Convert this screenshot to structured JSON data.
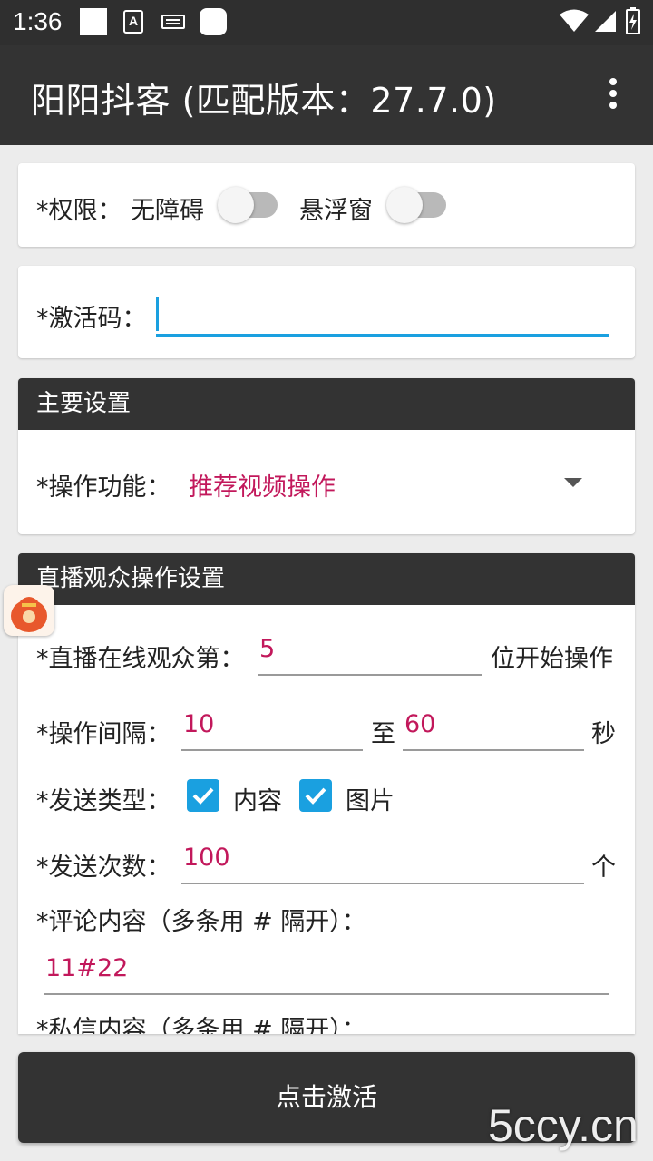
{
  "status_bar": {
    "time": "1:36",
    "icons": [
      "notification-icon",
      "a-icon",
      "keyboard-icon",
      "notification-icon-2",
      "wifi-icon",
      "signal-icon",
      "battery-icon"
    ]
  },
  "app_bar": {
    "title": "阳阳抖客 (匹配版本：27.7.0)",
    "menu_icon": "overflow-menu-icon"
  },
  "permissions": {
    "label": "*权限：",
    "accessibility_label": "无障碍",
    "accessibility_on": false,
    "floating_label": "悬浮窗",
    "floating_on": false
  },
  "activation": {
    "label": "*激活码：",
    "value": ""
  },
  "main_settings": {
    "header": "主要设置",
    "function_label": "*操作功能：",
    "function_value": "推荐视频操作"
  },
  "live_settings": {
    "header": "直播观众操作设置",
    "viewer_label": "*直播在线观众第：",
    "viewer_value": "5",
    "viewer_suffix": "位开始操作",
    "interval_label": "*操作间隔：",
    "interval_from": "10",
    "interval_to_label": "至",
    "interval_to": "60",
    "interval_unit": "秒",
    "send_type_label": "*发送类型：",
    "send_type_content": "内容",
    "send_type_content_checked": true,
    "send_type_image": "图片",
    "send_type_image_checked": true,
    "send_count_label": "*发送次数：",
    "send_count_value": "100",
    "send_count_unit": "个",
    "comment_label": "*评论内容（多条用 # 隔开）：",
    "comment_value": "11#22",
    "dm_label": "*私信内容（多条用 # 隔开）："
  },
  "activate_button": "点击激活",
  "watermark": "5ccy.cn",
  "colors": {
    "dark_bar": "#333333",
    "accent": "#1aa0e0",
    "value_red": "#c2185b"
  }
}
